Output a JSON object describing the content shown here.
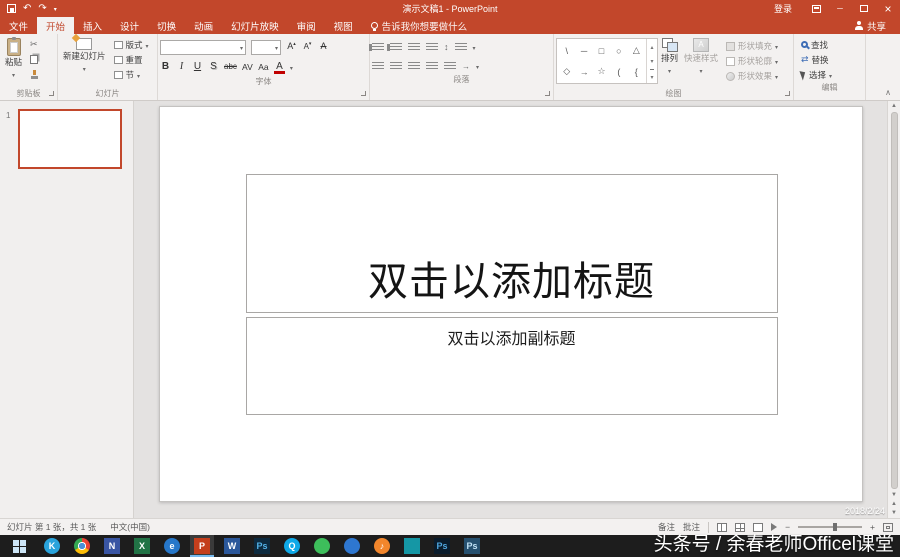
{
  "colors": {
    "accent": "#C2472B",
    "taskbar_active_underline": "#76B9ED"
  },
  "titlebar": {
    "title": "演示文稿1 - PowerPoint",
    "signin_label": "登录"
  },
  "tabs": {
    "items": [
      {
        "label": "文件"
      },
      {
        "label": "开始"
      },
      {
        "label": "插入"
      },
      {
        "label": "设计"
      },
      {
        "label": "切换"
      },
      {
        "label": "动画"
      },
      {
        "label": "幻灯片放映"
      },
      {
        "label": "审阅"
      },
      {
        "label": "视图"
      }
    ],
    "tellme_label": "告诉我你想要做什么",
    "share_label": "共享"
  },
  "ribbon": {
    "clipboard": {
      "group_label": "剪贴板",
      "paste_label": "粘贴"
    },
    "slides": {
      "group_label": "幻灯片",
      "new_slide_label": "新建幻灯片",
      "layout_label": "版式",
      "reset_label": "重置",
      "section_label": "节"
    },
    "font": {
      "group_label": "字体",
      "name_value": "",
      "size_value": "",
      "bold": "B",
      "italic": "I",
      "underline": "U",
      "shadow": "S",
      "strike": "abc",
      "spacing": "AV",
      "case": "Aa",
      "color": "A"
    },
    "paragraph": {
      "group_label": "段落"
    },
    "drawing": {
      "group_label": "绘图",
      "arrange_label": "排列",
      "quick_styles_label": "快速样式",
      "fill_label": "形状填充",
      "outline_label": "形状轮廓",
      "effects_label": "形状效果",
      "shapes": [
        "\\",
        "─",
        "□",
        "○",
        "△",
        "◇",
        "→",
        "☆",
        "(",
        "{"
      ]
    },
    "editing": {
      "group_label": "编辑",
      "find_label": "查找",
      "replace_label": "替换",
      "select_label": "选择"
    }
  },
  "thumbnails": {
    "slide_number": "1"
  },
  "slide": {
    "title_placeholder": "双击以添加标题",
    "subtitle_placeholder": "双击以添加副标题"
  },
  "statusbar": {
    "slide_counter": "幻灯片 第 1 张，共 1 张",
    "language": "中文(中国)",
    "notes_label": "备注",
    "comments_label": "批注"
  },
  "overlay": {
    "watermark": "头条号 / 余春老师Officel课堂",
    "date": "2018/2/24"
  },
  "taskbar": {
    "icons": [
      {
        "name": "kugou",
        "glyph": "K",
        "bg": "#29A3DC",
        "fg": "#ffffff"
      },
      {
        "name": "chrome",
        "glyph": "",
        "bg": "radial-gradient(circle, #4A90D9 0 27%, #ffffff 27% 36%, rgba(0,0,0,0) 36%), conic-gradient(#EA4335 0deg 120deg, #FBBC05 120deg 240deg, #34A853 240deg 360deg)",
        "fg": "#ffffff"
      },
      {
        "name": "onenote",
        "glyph": "N",
        "bg": "#3955A3",
        "fg": "#ffffff"
      },
      {
        "name": "excel",
        "glyph": "X",
        "bg": "#217346",
        "fg": "#ffffff"
      },
      {
        "name": "edge",
        "glyph": "e",
        "bg": "#2677C9",
        "fg": "#ffffff"
      },
      {
        "name": "powerpoint",
        "glyph": "P",
        "bg": "#C43E1C",
        "fg": "#ffffff"
      },
      {
        "name": "word",
        "glyph": "W",
        "bg": "#2B579A",
        "fg": "#ffffff"
      },
      {
        "name": "photoshop",
        "glyph": "Ps",
        "bg": "#0D2A3F",
        "fg": "#53B2E8"
      },
      {
        "name": "qq",
        "glyph": "Q",
        "bg": "#0FA9E8",
        "fg": "#ffffff"
      },
      {
        "name": "app-green",
        "glyph": "",
        "bg": "#3DBE5B",
        "fg": "#ffffff"
      },
      {
        "name": "app-blue",
        "glyph": "",
        "bg": "#2E77D0",
        "fg": "#ffffff"
      },
      {
        "name": "music",
        "glyph": "♪",
        "bg": "#F2862C",
        "fg": "#ffffff"
      },
      {
        "name": "app-teal",
        "glyph": "",
        "bg": "#1597A5",
        "fg": "#ffffff"
      },
      {
        "name": "photoshop-2",
        "glyph": "Ps",
        "bg": "#0A1C2C",
        "fg": "#4FA6DF"
      },
      {
        "name": "photoshop-3",
        "glyph": "Ps",
        "bg": "#26506F",
        "fg": "#C2E3F7"
      }
    ]
  }
}
